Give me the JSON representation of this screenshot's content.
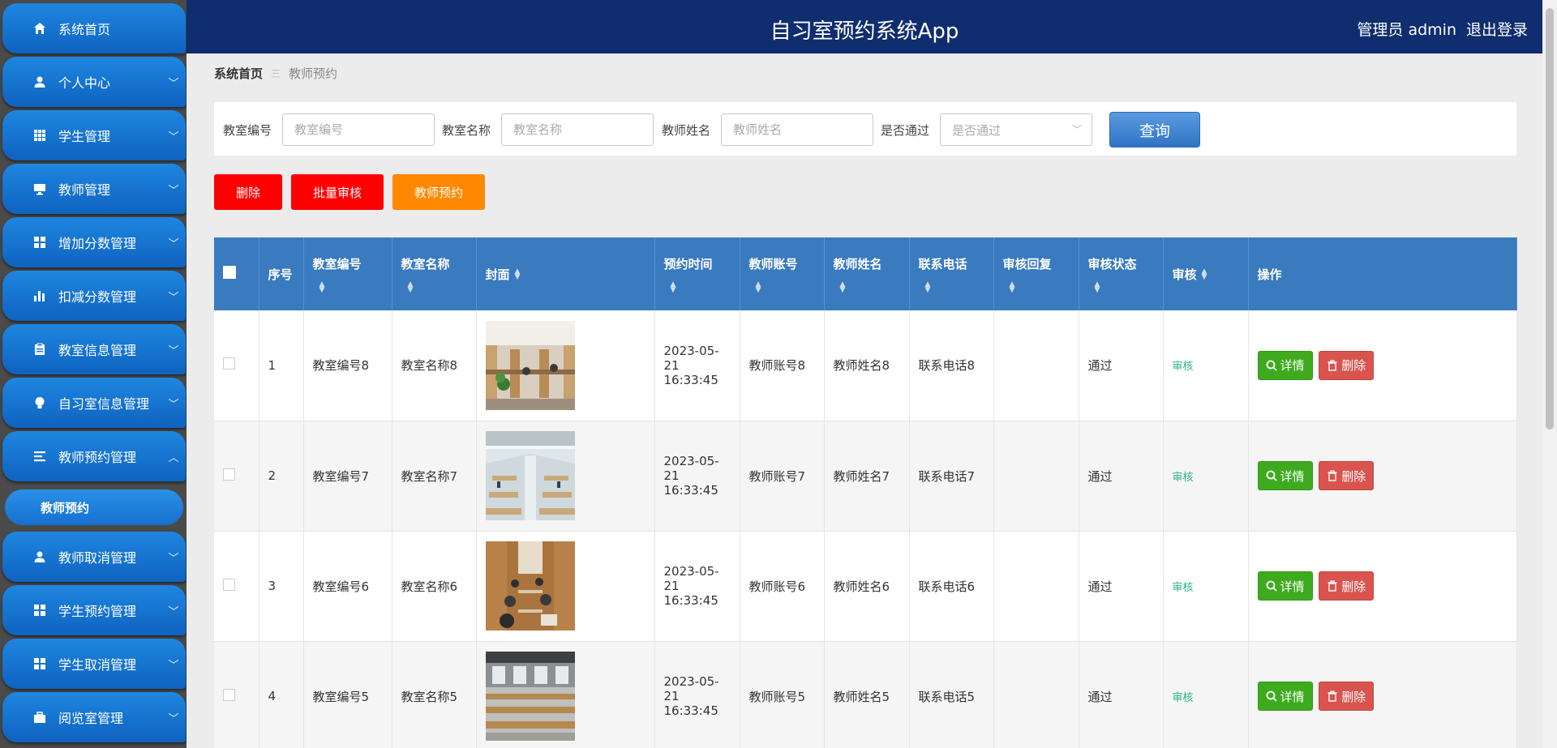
{
  "header": {
    "title": "自习室预约系统App",
    "user": "管理员 admin",
    "logout": "退出登录"
  },
  "sidebar": {
    "items": [
      {
        "label": "系统首页",
        "icon": "home-icon",
        "has_children": false
      },
      {
        "label": "个人中心",
        "icon": "user-icon",
        "has_children": true
      },
      {
        "label": "学生管理",
        "icon": "grid-icon",
        "has_children": true
      },
      {
        "label": "教师管理",
        "icon": "monitor-icon",
        "has_children": true
      },
      {
        "label": "增加分数管理",
        "icon": "apps-icon",
        "has_children": true
      },
      {
        "label": "扣减分数管理",
        "icon": "bar-chart-icon",
        "has_children": true
      },
      {
        "label": "教室信息管理",
        "icon": "clipboard-icon",
        "has_children": true
      },
      {
        "label": "自习室信息管理",
        "icon": "bulb-icon",
        "has_children": true
      },
      {
        "label": "教师预约管理",
        "icon": "list-icon",
        "has_children": true,
        "expanded": true
      },
      {
        "label": "教师取消管理",
        "icon": "user-icon",
        "has_children": true
      },
      {
        "label": "学生预约管理",
        "icon": "apps-icon",
        "has_children": true
      },
      {
        "label": "学生取消管理",
        "icon": "apps-icon",
        "has_children": true
      },
      {
        "label": "阅览室管理",
        "icon": "briefcase-icon",
        "has_children": true
      }
    ],
    "active_sub": "教师预约"
  },
  "breadcrumb": {
    "home": "系统首页",
    "separator": "三",
    "current": "教师预约"
  },
  "search": {
    "room_no_label": "教室编号",
    "room_no_placeholder": "教室编号",
    "room_name_label": "教室名称",
    "room_name_placeholder": "教室名称",
    "teacher_name_label": "教师姓名",
    "teacher_name_placeholder": "教师姓名",
    "passed_label": "是否通过",
    "passed_placeholder": "是否通过",
    "query": "查询"
  },
  "actions": {
    "delete": "删除",
    "batch_audit": "批量审核",
    "reserve": "教师预约"
  },
  "table": {
    "columns": [
      "序号",
      "教室编号",
      "教室名称",
      "封面",
      "预约时间",
      "教师账号",
      "教师姓名",
      "联系电话",
      "审核回复",
      "审核状态",
      "审核",
      "操作"
    ],
    "rows": [
      {
        "no": "1",
        "room_no": "教室编号8",
        "room_name": "教室名称8",
        "time": "2023-05-21 16:33:45",
        "account": "教师账号8",
        "teacher": "教师姓名8",
        "phone": "联系电话8",
        "reply": "",
        "status": "通过",
        "audit": "审核",
        "detail": "详情",
        "delete": "删除"
      },
      {
        "no": "2",
        "room_no": "教室编号7",
        "room_name": "教室名称7",
        "time": "2023-05-21 16:33:45",
        "account": "教师账号7",
        "teacher": "教师姓名7",
        "phone": "联系电话7",
        "reply": "",
        "status": "通过",
        "audit": "审核",
        "detail": "详情",
        "delete": "删除"
      },
      {
        "no": "3",
        "room_no": "教室编号6",
        "room_name": "教室名称6",
        "time": "2023-05-21 16:33:45",
        "account": "教师账号6",
        "teacher": "教师姓名6",
        "phone": "联系电话6",
        "reply": "",
        "status": "通过",
        "audit": "审核",
        "detail": "详情",
        "delete": "删除"
      },
      {
        "no": "4",
        "room_no": "教室编号5",
        "room_name": "教室名称5",
        "time": "2023-05-21 16:33:45",
        "account": "教师账号5",
        "teacher": "教师姓名5",
        "phone": "联系电话5",
        "reply": "",
        "status": "通过",
        "audit": "审核",
        "detail": "详情",
        "delete": "删除"
      }
    ]
  },
  "colors": {
    "header": "#0f2d6f",
    "menu": "#1577d6",
    "table_head": "#3a7abf",
    "danger": "#ff0000",
    "warning": "#ff8800",
    "success": "#3eab1e",
    "link_green": "#2cb67d"
  }
}
